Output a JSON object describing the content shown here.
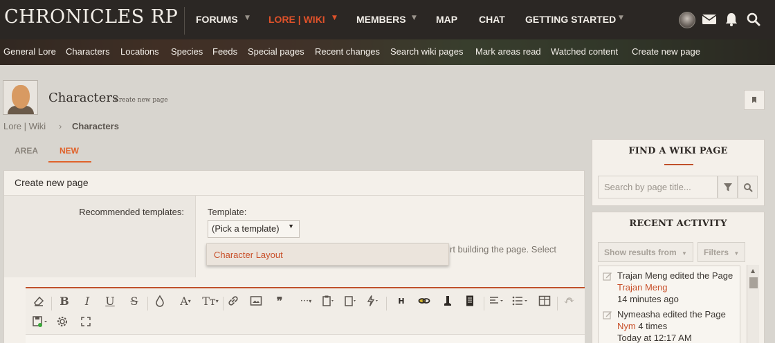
{
  "brand": {
    "logo": "CHRONICLES RP"
  },
  "nav": {
    "items": [
      {
        "label": "FORUMS"
      },
      {
        "label": "LORE | WIKI"
      },
      {
        "label": "MEMBERS"
      },
      {
        "label": "MAP"
      },
      {
        "label": "CHAT"
      },
      {
        "label": "GETTING STARTED"
      }
    ],
    "active": "LORE | WIKI",
    "accent": "#e0522a"
  },
  "subnav": {
    "items": [
      "General Lore",
      "Characters",
      "Locations",
      "Species",
      "Feeds",
      "Special pages",
      "Recent changes",
      "Search wiki pages",
      "Mark areas read",
      "Watched content",
      "Create new page"
    ]
  },
  "page": {
    "title": "Characters",
    "subtitle": "Create new page",
    "breadcrumb": [
      "Lore | Wiki",
      "Characters"
    ]
  },
  "tabs": [
    "AREA",
    "NEW"
  ],
  "form": {
    "heading": "Create new page",
    "recommended_label": "Recommended templates:",
    "template_label": "Template:",
    "template_value": "(Pick a template)",
    "hint": "rt building the page. Select",
    "dropdown_option": "Character Layout"
  },
  "sidebar": {
    "find": {
      "title": "FIND A WIKI PAGE",
      "placeholder": "Search by page title..."
    },
    "activity": {
      "title": "RECENT ACTIVITY",
      "show_results": "Show results from",
      "filters": "Filters",
      "items": [
        {
          "line1": "Trajan Meng edited the Page",
          "link": "Trajan Meng",
          "suffix": "",
          "time": "14 minutes ago"
        },
        {
          "line1": "Nymeasha edited the Page",
          "link": "Nym",
          "suffix": " 4 times",
          "time": "Today at 12:17 AM"
        }
      ]
    }
  }
}
